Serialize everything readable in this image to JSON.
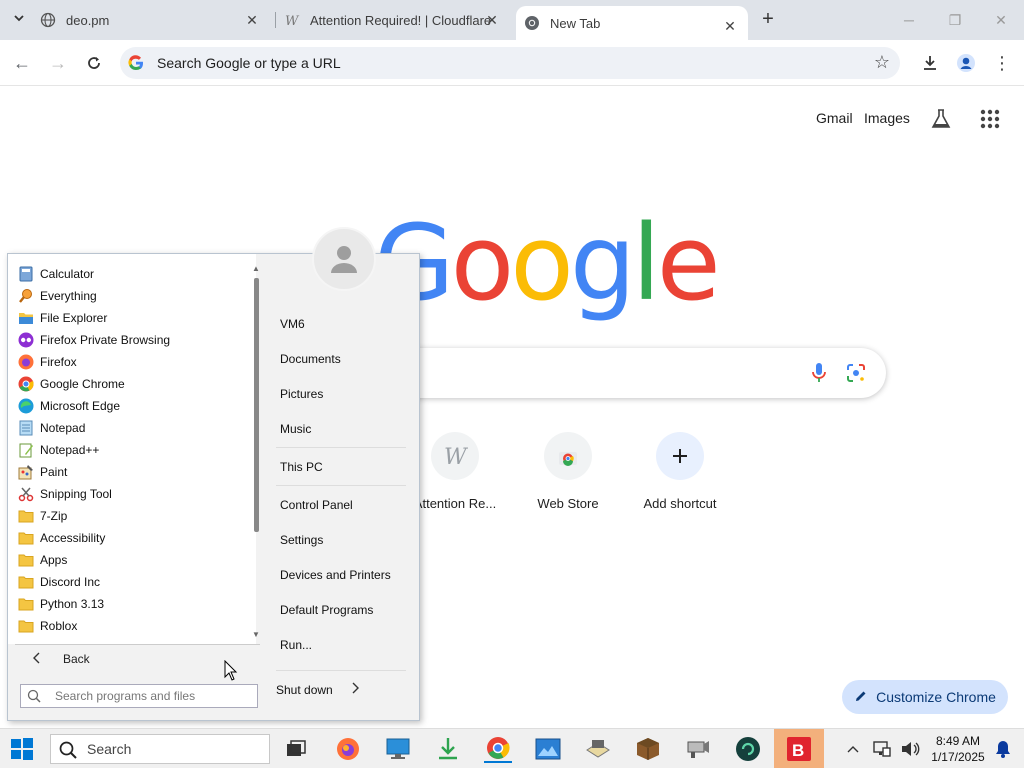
{
  "tabs": [
    {
      "title": "deo.pm",
      "icon": "globe-icon"
    },
    {
      "title": "Attention Required! | Cloudflare",
      "icon": "wordpress-icon"
    },
    {
      "title": "New Tab",
      "icon": "chrome-icon"
    }
  ],
  "omnibox": {
    "placeholder": "Search Google or type a URL"
  },
  "google": {
    "links": {
      "gmail": "Gmail",
      "images": "Images"
    },
    "logo": [
      "G",
      "o",
      "o",
      "g",
      "l",
      "e"
    ],
    "shortcuts": [
      {
        "label": "Attention Re...",
        "icon": "wordpress-icon"
      },
      {
        "label": "Web Store",
        "icon": "chrome-webstore-icon"
      },
      {
        "label": "Add shortcut",
        "icon": "plus-icon"
      }
    ],
    "customize": "Customize Chrome"
  },
  "start_menu": {
    "programs": [
      {
        "label": "Calculator",
        "icon": "calculator-icon"
      },
      {
        "label": "Everything",
        "icon": "search-icon"
      },
      {
        "label": "File Explorer",
        "icon": "folder-icon"
      },
      {
        "label": "Firefox Private Browsing",
        "icon": "firefox-private-icon"
      },
      {
        "label": "Firefox",
        "icon": "firefox-icon"
      },
      {
        "label": "Google Chrome",
        "icon": "chrome-icon"
      },
      {
        "label": "Microsoft Edge",
        "icon": "edge-icon"
      },
      {
        "label": "Notepad",
        "icon": "notepad-icon"
      },
      {
        "label": "Notepad++",
        "icon": "notepadpp-icon"
      },
      {
        "label": "Paint",
        "icon": "paint-icon"
      },
      {
        "label": "Snipping Tool",
        "icon": "snipping-icon"
      },
      {
        "label": "7-Zip",
        "icon": "folder-icon"
      },
      {
        "label": "Accessibility",
        "icon": "folder-icon"
      },
      {
        "label": "Apps",
        "icon": "folder-icon"
      },
      {
        "label": "Discord Inc",
        "icon": "folder-icon"
      },
      {
        "label": "Python 3.13",
        "icon": "folder-icon"
      },
      {
        "label": "Roblox",
        "icon": "folder-icon"
      }
    ],
    "back": "Back",
    "search_placeholder": "Search programs and files",
    "right_items": {
      "user": "VM6",
      "documents": "Documents",
      "pictures": "Pictures",
      "music": "Music",
      "this_pc": "This PC",
      "control_panel": "Control Panel",
      "settings": "Settings",
      "devices": "Devices and Printers",
      "default_programs": "Default Programs",
      "run": "Run..."
    },
    "shutdown": "Shut down"
  },
  "taskbar": {
    "search_placeholder": "Search",
    "clock_time": "8:49 AM",
    "clock_date": "1/17/2025"
  }
}
